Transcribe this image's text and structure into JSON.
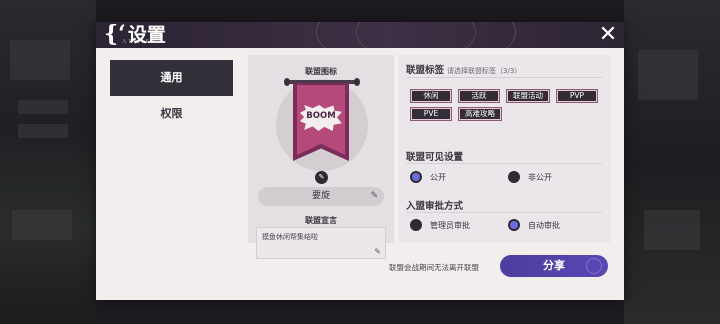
{
  "dialog": {
    "title": "设置",
    "title_brace": "{‘",
    "subtitle": "ARMIFA",
    "close_glyph": "✕"
  },
  "sidebar": {
    "items": [
      {
        "label": "通用",
        "active": true
      },
      {
        "label": "权限",
        "active": false
      }
    ]
  },
  "alliance_card": {
    "emblem_title": "联盟图标",
    "emblem_text": "BOOM",
    "emblem_colors": {
      "outer": "#7a2d5a",
      "inner": "#b5497a"
    },
    "name": "要旋",
    "declaration_title": "联盟宣言",
    "declaration_text": "摸鱼休闲帮集结啦"
  },
  "tags_section": {
    "title": "联盟标签",
    "hint": "请选择联盟标签（3/3）",
    "tags": [
      "休闲",
      "活跃",
      "联盟活动",
      "PVP",
      "PVE",
      "高难攻略"
    ]
  },
  "visibility_section": {
    "title": "联盟可见设置",
    "options": [
      {
        "label": "公开",
        "selected": true
      },
      {
        "label": "非公开",
        "selected": false
      }
    ]
  },
  "approval_section": {
    "title": "入盟审批方式",
    "options": [
      {
        "label": "管理员审批",
        "selected": false
      },
      {
        "label": "自动审批",
        "selected": true
      }
    ]
  },
  "footer": {
    "note": "联盟会战期间无法离开联盟",
    "share_label": "分享"
  },
  "colors": {
    "accent": "#5947b4",
    "radio_on": "#6c6ee0",
    "tag_bg": "#322d37"
  }
}
